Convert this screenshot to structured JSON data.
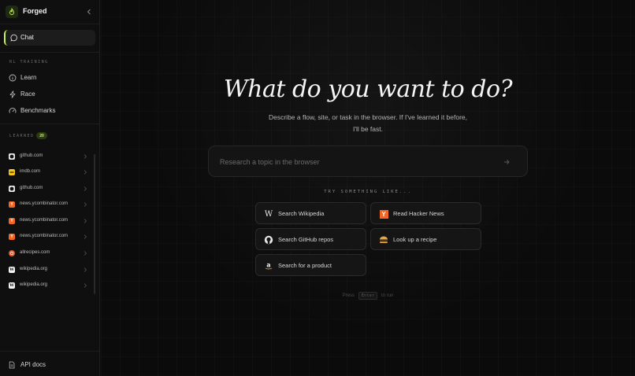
{
  "app": {
    "name": "Forged"
  },
  "sidebar": {
    "chat_label": "Chat",
    "rl_section": "RL TRAINING",
    "nav": [
      {
        "label": "Learn",
        "icon": "info-icon"
      },
      {
        "label": "Race",
        "icon": "bolt-icon"
      },
      {
        "label": "Benchmarks",
        "icon": "gauge-icon"
      }
    ],
    "learned_section": "LEARNED",
    "learned_count": "20",
    "learned_items": [
      {
        "label": "github.com",
        "icon": "github-favicon"
      },
      {
        "label": "imdb.com",
        "icon": "imdb-favicon"
      },
      {
        "label": "github.com",
        "icon": "github-favicon"
      },
      {
        "label": "news.ycombinator.com",
        "icon": "ycombinator-favicon"
      },
      {
        "label": "news.ycombinator.com",
        "icon": "ycombinator-favicon"
      },
      {
        "label": "news.ycombinator.com",
        "icon": "ycombinator-favicon"
      },
      {
        "label": "allrecipes.com",
        "icon": "allrecipes-favicon"
      },
      {
        "label": "wikipedia.org",
        "icon": "wikipedia-favicon"
      },
      {
        "label": "wikipedia.org",
        "icon": "wikipedia-favicon"
      }
    ],
    "api_docs_label": "API docs"
  },
  "main": {
    "headline": "What do you want to do?",
    "subtitle": "Describe a flow, site, or task in the browser. If I've learned it before, I'll be fast.",
    "input": {
      "placeholder": "Research a topic in the browser",
      "value": ""
    },
    "try_label": "TRY SOMETHING LIKE...",
    "suggestions": [
      {
        "label": "Search Wikipedia",
        "icon": "wikipedia-icon"
      },
      {
        "label": "Read Hacker News",
        "icon": "ycombinator-icon"
      },
      {
        "label": "Search GitHub repos",
        "icon": "github-icon"
      },
      {
        "label": "Look up a recipe",
        "icon": "burger-icon"
      },
      {
        "label": "Search for a product",
        "icon": "amazon-icon"
      }
    ],
    "hint": {
      "before": "Press",
      "key": "Enter",
      "after": "to run"
    }
  },
  "colors": {
    "accent": "#c7f35a",
    "background": "#0b0b0b",
    "hn_orange": "#f26522"
  }
}
